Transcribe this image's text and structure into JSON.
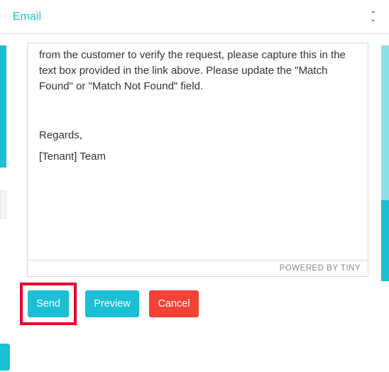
{
  "header": {
    "title": "Email"
  },
  "editor": {
    "body_line1": "from the customer to verify the request, please capture this in the text box provided in the link above. Please update the \"Match Found\" or \"Match Not Found\" field.",
    "sign1": "Regards,",
    "sign2": "[Tenant] Team",
    "footer": "POWERED BY TINY"
  },
  "buttons": {
    "send": "Send",
    "preview": "Preview",
    "cancel": "Cancel"
  }
}
